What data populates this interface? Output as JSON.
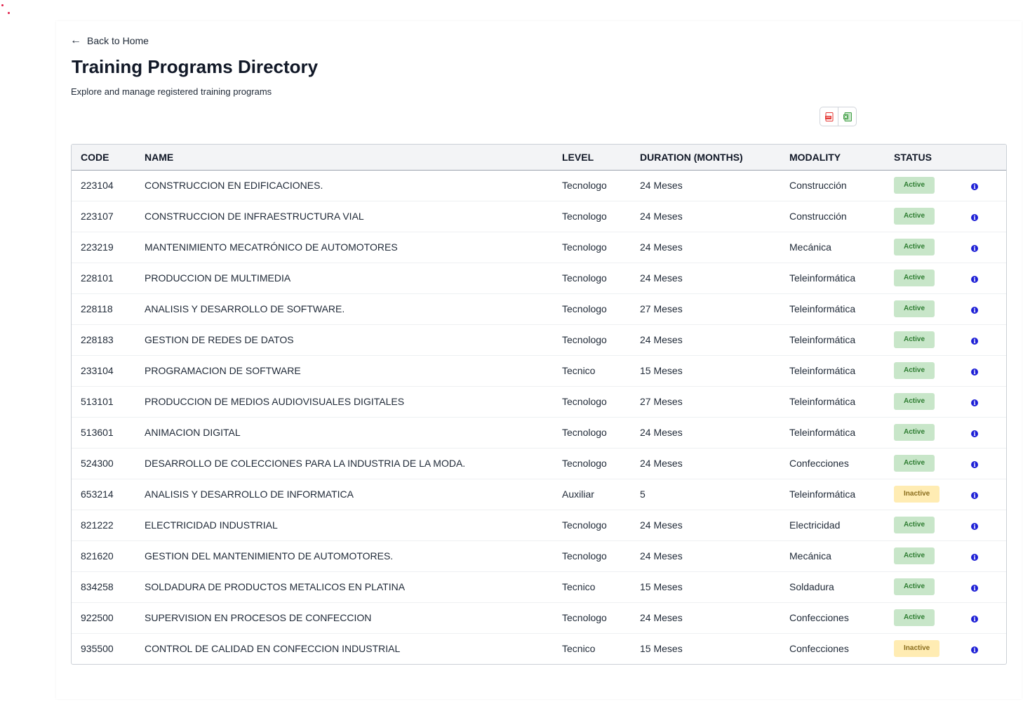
{
  "nav": {
    "back_label": "Back to Home",
    "back_icon": "arrow-left-icon"
  },
  "header": {
    "title": "Training Programs Directory",
    "subtitle": "Explore and manage registered training programs"
  },
  "exports": {
    "pdf_icon": "pdf-file-icon",
    "excel_icon": "excel-file-icon",
    "pdf_color": "#e53935",
    "excel_color": "#43a047"
  },
  "table": {
    "columns": [
      "CODE",
      "NAME",
      "LEVEL",
      "DURATION (MONTHS)",
      "MODALITY",
      "STATUS"
    ],
    "rows": [
      {
        "code": "223104",
        "name": "CONSTRUCCION EN EDIFICACIONES.",
        "level": "Tecnologo",
        "duration": "24 Meses",
        "modality": "Construcción",
        "status": "Active"
      },
      {
        "code": "223107",
        "name": "CONSTRUCCION DE INFRAESTRUCTURA VIAL",
        "level": "Tecnologo",
        "duration": "24 Meses",
        "modality": "Construcción",
        "status": "Active"
      },
      {
        "code": "223219",
        "name": "MANTENIMIENTO MECATRÓNICO DE AUTOMOTORES",
        "level": "Tecnologo",
        "duration": "24 Meses",
        "modality": "Mecánica",
        "status": "Active"
      },
      {
        "code": "228101",
        "name": "PRODUCCION DE MULTIMEDIA",
        "level": "Tecnologo",
        "duration": "24 Meses",
        "modality": "Teleinformática",
        "status": "Active"
      },
      {
        "code": "228118",
        "name": "ANALISIS Y DESARROLLO DE SOFTWARE.",
        "level": "Tecnologo",
        "duration": "27 Meses",
        "modality": "Teleinformática",
        "status": "Active"
      },
      {
        "code": "228183",
        "name": "GESTION DE REDES DE DATOS",
        "level": "Tecnologo",
        "duration": "24 Meses",
        "modality": "Teleinformática",
        "status": "Active"
      },
      {
        "code": "233104",
        "name": "PROGRAMACION DE SOFTWARE",
        "level": "Tecnico",
        "duration": "15 Meses",
        "modality": "Teleinformática",
        "status": "Active"
      },
      {
        "code": "513101",
        "name": "PRODUCCION DE MEDIOS AUDIOVISUALES DIGITALES",
        "level": "Tecnologo",
        "duration": "27 Meses",
        "modality": "Teleinformática",
        "status": "Active"
      },
      {
        "code": "513601",
        "name": "ANIMACION DIGITAL",
        "level": "Tecnologo",
        "duration": "24 Meses",
        "modality": "Teleinformática",
        "status": "Active"
      },
      {
        "code": "524300",
        "name": "DESARROLLO DE COLECCIONES PARA LA INDUSTRIA DE LA MODA.",
        "level": "Tecnologo",
        "duration": "24 Meses",
        "modality": "Confecciones",
        "status": "Active"
      },
      {
        "code": "653214",
        "name": "ANALISIS Y DESARROLLO DE INFORMATICA",
        "level": "Auxiliar",
        "duration": "5",
        "modality": "Teleinformática",
        "status": "Inactive"
      },
      {
        "code": "821222",
        "name": "ELECTRICIDAD INDUSTRIAL",
        "level": "Tecnologo",
        "duration": "24 Meses",
        "modality": "Electricidad",
        "status": "Active"
      },
      {
        "code": "821620",
        "name": "GESTION DEL MANTENIMIENTO DE AUTOMOTORES.",
        "level": "Tecnologo",
        "duration": "24 Meses",
        "modality": "Mecánica",
        "status": "Active"
      },
      {
        "code": "834258",
        "name": "SOLDADURA DE PRODUCTOS METALICOS EN PLATINA",
        "level": "Tecnico",
        "duration": "15 Meses",
        "modality": "Soldadura",
        "status": "Active"
      },
      {
        "code": "922500",
        "name": "SUPERVISION EN PROCESOS DE CONFECCION",
        "level": "Tecnologo",
        "duration": "24 Meses",
        "modality": "Confecciones",
        "status": "Active"
      },
      {
        "code": "935500",
        "name": "CONTROL DE CALIDAD EN CONFECCION INDUSTRIAL",
        "level": "Tecnico",
        "duration": "15 Meses",
        "modality": "Confecciones",
        "status": "Inactive"
      }
    ],
    "row_action_icon": "info-circle-icon"
  },
  "colors": {
    "active_bg": "#c8e6c9",
    "active_text": "#2e7d32",
    "inactive_bg": "#ffecb3",
    "inactive_text": "#8a6d1d",
    "info": "#1d1fd6"
  }
}
